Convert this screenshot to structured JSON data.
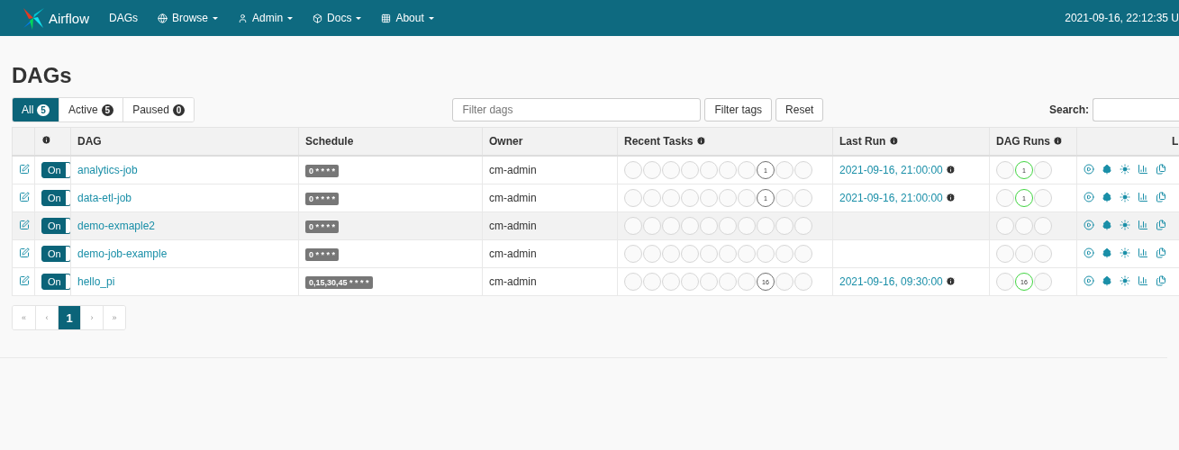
{
  "navbar": {
    "brand": "Airflow",
    "items": [
      {
        "label": "DAGs",
        "kind": "link"
      },
      {
        "label": "Browse",
        "kind": "globe"
      },
      {
        "label": "Admin",
        "kind": "user"
      },
      {
        "label": "Docs",
        "kind": "cube"
      },
      {
        "label": "About",
        "kind": "grid"
      }
    ],
    "clock": "2021-09-16, 22:12:35 U"
  },
  "page_title": "DAGs",
  "status_filters": [
    {
      "label": "All",
      "count": "5",
      "selected": true
    },
    {
      "label": "Active",
      "count": "5",
      "selected": false
    },
    {
      "label": "Paused",
      "count": "0",
      "selected": false
    }
  ],
  "filter": {
    "placeholder": "Filter dags",
    "tags_button": "Filter tags",
    "reset_button": "Reset"
  },
  "search": {
    "label": "Search:"
  },
  "table": {
    "columns": [
      "DAG",
      "Schedule",
      "Owner",
      "Recent Tasks",
      "Last Run",
      "DAG Runs",
      "L"
    ],
    "rows": [
      {
        "on": true,
        "toggle_label": "On",
        "highlighted": false,
        "dag": "analytics-job",
        "schedule": "0 * * * *",
        "owner": "cm-admin",
        "last_run": "2021-09-16, 21:00:00",
        "recent_tasks": [
          {
            "kind": "empty"
          },
          {
            "kind": "empty"
          },
          {
            "kind": "empty"
          },
          {
            "kind": "empty"
          },
          {
            "kind": "empty"
          },
          {
            "kind": "empty"
          },
          {
            "kind": "empty"
          },
          {
            "kind": "count",
            "count": "1",
            "color": "#707070"
          },
          {
            "kind": "empty"
          },
          {
            "kind": "empty"
          }
        ],
        "dag_runs": [
          {
            "kind": "empty"
          },
          {
            "kind": "count",
            "count": "1",
            "color": "#3fd43f"
          },
          {
            "kind": "empty"
          }
        ]
      },
      {
        "on": true,
        "toggle_label": "On",
        "highlighted": false,
        "dag": "data-etl-job",
        "schedule": "0 * * * *",
        "owner": "cm-admin",
        "last_run": "2021-09-16, 21:00:00",
        "recent_tasks": [
          {
            "kind": "empty"
          },
          {
            "kind": "empty"
          },
          {
            "kind": "empty"
          },
          {
            "kind": "empty"
          },
          {
            "kind": "empty"
          },
          {
            "kind": "empty"
          },
          {
            "kind": "empty"
          },
          {
            "kind": "count",
            "count": "1",
            "color": "#707070"
          },
          {
            "kind": "empty"
          },
          {
            "kind": "empty"
          }
        ],
        "dag_runs": [
          {
            "kind": "empty"
          },
          {
            "kind": "count",
            "count": "1",
            "color": "#3fd43f"
          },
          {
            "kind": "empty"
          }
        ]
      },
      {
        "on": true,
        "toggle_label": "On",
        "highlighted": true,
        "dag": "demo-exmaple2",
        "schedule": "0 * * * *",
        "owner": "cm-admin",
        "recent_tasks": [
          {
            "kind": "empty"
          },
          {
            "kind": "empty"
          },
          {
            "kind": "empty"
          },
          {
            "kind": "empty"
          },
          {
            "kind": "empty"
          },
          {
            "kind": "empty"
          },
          {
            "kind": "empty"
          },
          {
            "kind": "empty"
          },
          {
            "kind": "empty"
          },
          {
            "kind": "empty"
          }
        ],
        "dag_runs": [
          {
            "kind": "empty"
          },
          {
            "kind": "empty"
          },
          {
            "kind": "empty"
          }
        ]
      },
      {
        "on": true,
        "toggle_label": "On",
        "highlighted": false,
        "dag": "demo-job-example",
        "schedule": "0 * * * *",
        "owner": "cm-admin",
        "recent_tasks": [
          {
            "kind": "empty"
          },
          {
            "kind": "empty"
          },
          {
            "kind": "empty"
          },
          {
            "kind": "empty"
          },
          {
            "kind": "empty"
          },
          {
            "kind": "empty"
          },
          {
            "kind": "empty"
          },
          {
            "kind": "empty"
          },
          {
            "kind": "empty"
          },
          {
            "kind": "empty"
          }
        ],
        "dag_runs": [
          {
            "kind": "empty"
          },
          {
            "kind": "empty"
          },
          {
            "kind": "empty"
          }
        ]
      },
      {
        "on": true,
        "toggle_label": "On",
        "highlighted": false,
        "dag": "hello_pi",
        "schedule": "0,15,30,45 * * * *",
        "owner": "cm-admin",
        "last_run": "2021-09-16, 09:30:00",
        "recent_tasks": [
          {
            "kind": "empty"
          },
          {
            "kind": "empty"
          },
          {
            "kind": "empty"
          },
          {
            "kind": "empty"
          },
          {
            "kind": "empty"
          },
          {
            "kind": "empty"
          },
          {
            "kind": "empty"
          },
          {
            "kind": "count",
            "count": "16",
            "color": "#707070"
          },
          {
            "kind": "empty"
          },
          {
            "kind": "empty"
          }
        ],
        "dag_runs": [
          {
            "kind": "empty"
          },
          {
            "kind": "count",
            "count": "16",
            "color": "#3fd43f"
          },
          {
            "kind": "empty"
          }
        ]
      }
    ]
  },
  "pagination": [
    {
      "label": "«",
      "selected": false
    },
    {
      "label": "‹",
      "selected": false
    },
    {
      "label": "1",
      "selected": true
    },
    {
      "label": "›",
      "selected": false
    },
    {
      "label": "»",
      "selected": false
    }
  ]
}
